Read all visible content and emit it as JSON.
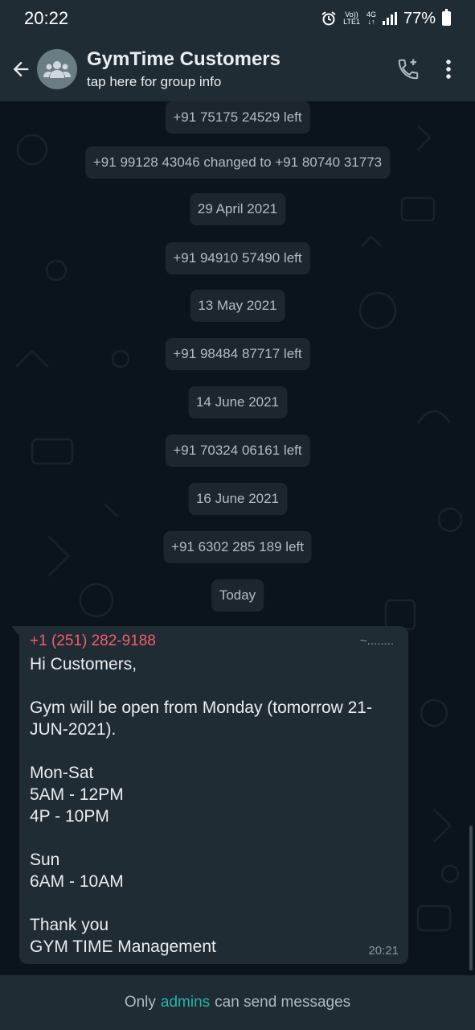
{
  "status": {
    "time": "20:22",
    "volte": "Vo))",
    "lte": "LTE1",
    "net": "4G",
    "battery": "77%"
  },
  "header": {
    "title": "GymTime Customers",
    "subtitle": "tap here for group info"
  },
  "system_messages": [
    "+91 75175 24529 left",
    "+91 99128 43046 changed to +91 80740 31773",
    "29 April 2021",
    "+91 94910 57490 left",
    "13 May 2021",
    "+91 98484 87717 left",
    "14 June 2021",
    "+91 70324 06161 left",
    "16 June 2021",
    "+91 6302 285 189 left",
    "Today"
  ],
  "message": {
    "sender": "+1 (251) 282-9188",
    "push_name": "~........",
    "text": "Hi Customers,\n\nGym will be open from Monday (tomorrow 21-JUN-2021).\n\nMon-Sat\n5AM - 12PM\n4P - 10PM\n\nSun\n6AM - 10AM\n\nThank you\nGYM TIME Management",
    "time": "20:21"
  },
  "footer": {
    "prefix": "Only",
    "link": "admins",
    "suffix": "can send messages"
  },
  "colors": {
    "header_bg": "#1f2c34",
    "chat_bg": "#0b141a",
    "sender": "#f15c6d",
    "accent": "#27b3a7"
  },
  "icons": [
    "back-arrow-icon",
    "group-avatar-icon",
    "add-call-icon",
    "more-vert-icon",
    "alarm-icon",
    "signal-icon",
    "battery-icon"
  ]
}
